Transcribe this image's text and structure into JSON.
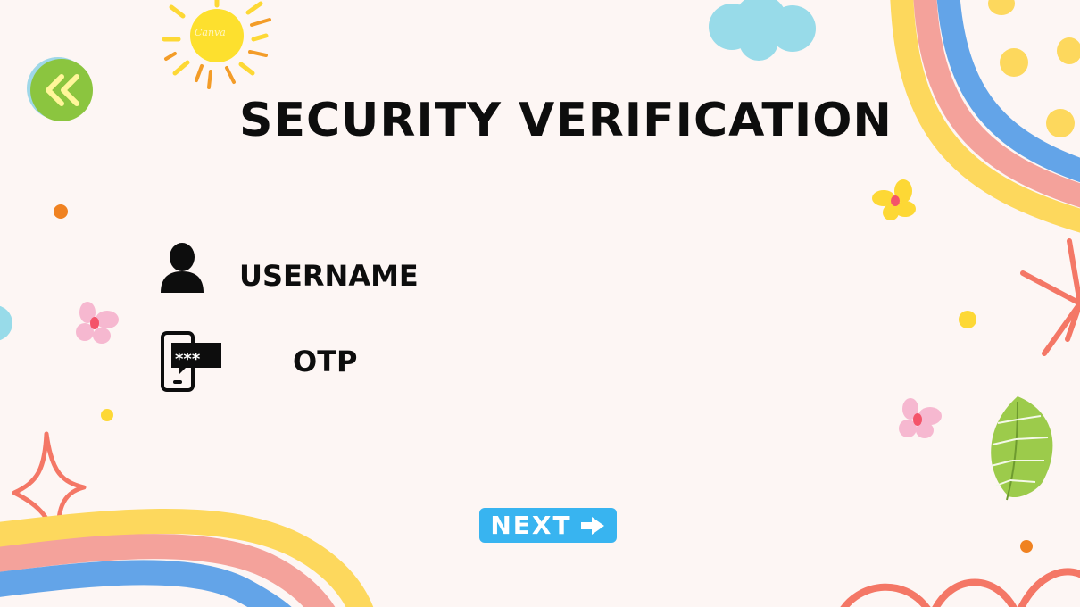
{
  "page": {
    "title": "SECURITY VERIFICATION",
    "background": "#fdf6f4"
  },
  "fields": [
    {
      "label": "USERNAME",
      "icon": "user-icon"
    },
    {
      "label": "OTP",
      "icon": "phone-otp-icon"
    }
  ],
  "navigation": {
    "back_icon": "double-chevron-left-icon",
    "next_label": "NEXT",
    "next_icon": "arrow-right-icon"
  },
  "decor": {
    "sun_text": "Canva"
  },
  "colors": {
    "back_button": "#8bc53f",
    "next_button": "#38b4f0",
    "rainbow": [
      "#fdd85d",
      "#f4a29b",
      "#63a4e8"
    ]
  }
}
